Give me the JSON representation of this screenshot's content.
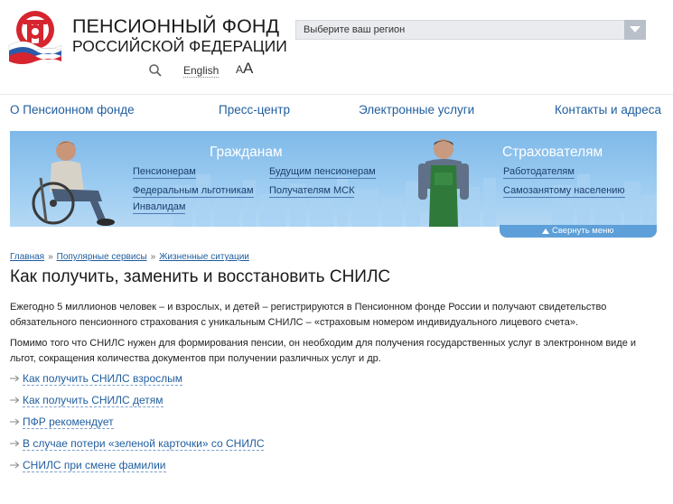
{
  "header": {
    "org_line1": "ПЕНСИОННЫЙ ФОНД",
    "org_line2": "РОССИЙСКОЙ ФЕДЕРАЦИИ",
    "region_select_value": "Выберите ваш регион",
    "lang_link": "English",
    "font_small": "A",
    "font_big": "A"
  },
  "nav": {
    "about": "О Пенсионном фонде",
    "press": "Пресс-центр",
    "eservices": "Электронные услуги",
    "contacts": "Контакты и адреса"
  },
  "banner": {
    "citizens_title": "Гражданам",
    "insurers_title": "Страхователям",
    "citizens_links": [
      "Пенсионерам",
      "Будущим пенсионерам",
      "Федеральным льготникам",
      "Получателям МСК",
      "Инвалидам"
    ],
    "insurers_links": [
      "Работодателям",
      "Самозанятому населению"
    ],
    "collapse_label": "Свернуть меню"
  },
  "breadcrumb": [
    "Главная",
    "Популярные сервисы",
    "Жизненные ситуации"
  ],
  "breadcrumb_sep": "»",
  "content": {
    "title": "Как получить, заменить и восстановить СНИЛС",
    "paragraph1": "Ежегодно 5 миллионов человек – и взрослых, и детей – регистрируются в Пенсионном фонде России и получают свидетельство обязательного пенсионного страхования с уникальным СНИЛС – «страховым номером индивидуального лицевого счета».",
    "paragraph2": "Помимо того что СНИЛС нужен для формирования пенсии, он необходим для получения государственных услуг в электронном виде и льгот, сокращения количества документов при получении различных услуг и др.",
    "links": [
      "Как получить СНИЛС взрослым",
      "Как получить СНИЛС детям",
      "ПФР рекомендует",
      "В случае потери «зеленой карточки» со СНИЛС",
      "СНИЛС при смене фамилии"
    ]
  },
  "colors": {
    "link_blue": "#1f5d9e",
    "logo_red": "#d6252e",
    "flag_blue": "#2b5caa",
    "banner_sky": "#8fc3ee"
  },
  "icons": {
    "search": "search-icon",
    "dropdown": "chevron-down-icon",
    "collapse": "triangle-up-icon",
    "arrow": "arrow-right-icon"
  }
}
